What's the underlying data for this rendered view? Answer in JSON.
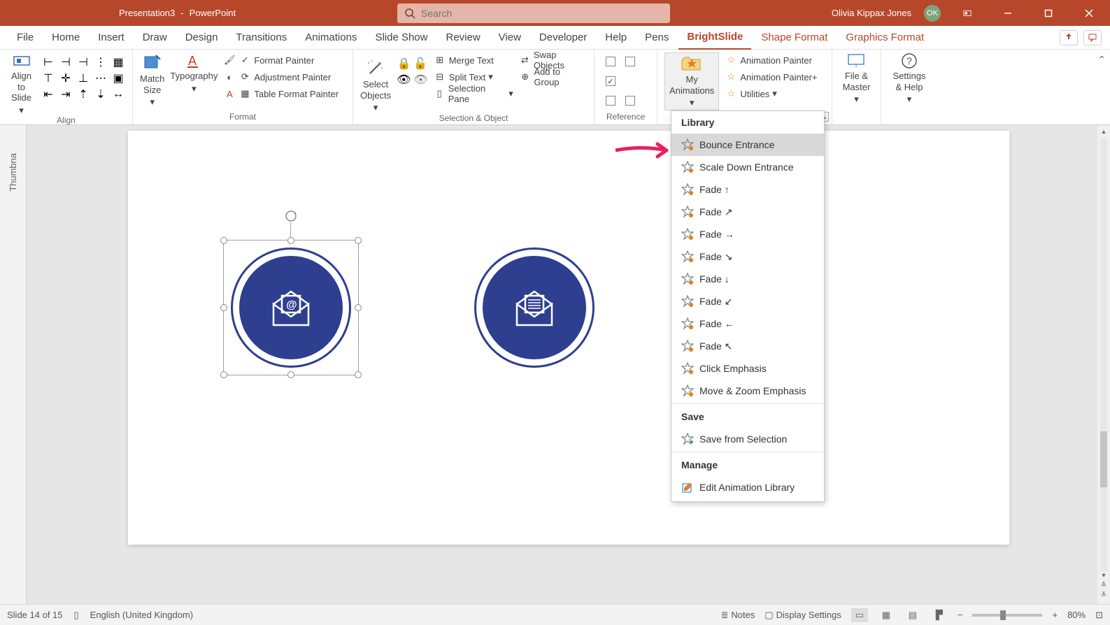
{
  "title": {
    "doc": "Presentation3",
    "separator": "-",
    "app": "PowerPoint"
  },
  "search": {
    "placeholder": "Search"
  },
  "user": {
    "name": "Olivia Kippax Jones",
    "initials": "OK"
  },
  "tabs": [
    "File",
    "Home",
    "Insert",
    "Draw",
    "Design",
    "Transitions",
    "Animations",
    "Slide Show",
    "Review",
    "View",
    "Developer",
    "Help",
    "Pens",
    "BrightSlide",
    "Shape Format",
    "Graphics Format"
  ],
  "active_tab": "BrightSlide",
  "colored_tabs": [
    "BrightSlide",
    "Shape Format",
    "Graphics Format"
  ],
  "ribbon": {
    "align": {
      "label": "Align",
      "big": "Align to\nSlide"
    },
    "format": {
      "label": "Format",
      "match_size": "Match\nSize",
      "typography": "Typography",
      "format_painter": "Format Painter",
      "adjustment_painter": "Adjustment Painter",
      "table_format_painter": "Table Format Painter"
    },
    "selection": {
      "label": "Selection & Object",
      "select_objects": "Select\nObjects",
      "merge_text": "Merge Text",
      "swap_objects": "Swap Objects",
      "split_text": "Split Text",
      "add_to_group": "Add to Group",
      "selection_pane": "Selection Pane"
    },
    "reference": {
      "label": "Reference"
    },
    "animations": {
      "my_animations": "My\nAnimations",
      "animation_painter": "Animation Painter",
      "animation_painter_plus": "Animation Painter+",
      "utilities": "Utilities"
    },
    "file_master": "File &\nMaster",
    "settings_help": "Settings\n& Help"
  },
  "dropdown": {
    "library_header": "Library",
    "items": [
      "Bounce Entrance",
      "Scale Down Entrance",
      "Fade ↑",
      "Fade ↗",
      "Fade →",
      "Fade ↘",
      "Fade ↓",
      "Fade ↙",
      "Fade ←",
      "Fade ↖",
      "Click Emphasis",
      "Move & Zoom Emphasis"
    ],
    "save_header": "Save",
    "save_item": "Save from Selection",
    "manage_header": "Manage",
    "manage_item": "Edit Animation Library"
  },
  "status": {
    "slide_info": "Slide 14 of 15",
    "language": "English (United Kingdom)",
    "notes": "Notes",
    "display_settings": "Display Settings",
    "zoom": "80%"
  },
  "thumb_label": "Thumbna"
}
